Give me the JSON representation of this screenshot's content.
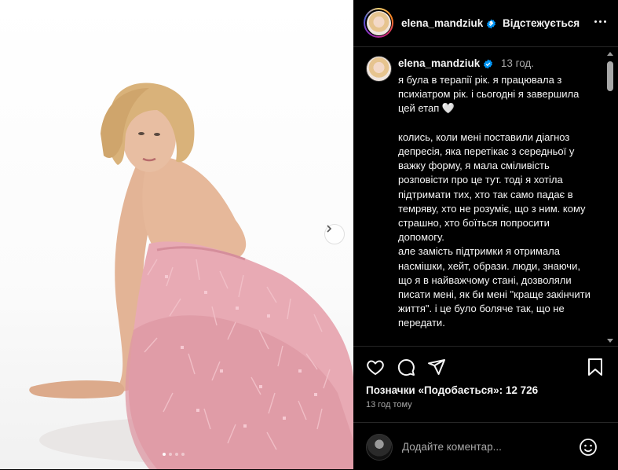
{
  "post": {
    "username": "elena_mandziuk",
    "follow_status": "Відстежується",
    "separator": "•",
    "time_ago": "13 год.",
    "caption": "я була в терапії рік. я працювала з психіатром рік. і сьогодні я завершила цей етап 🤍\n\nколись, коли мені поставили діагноз депресія, яка перетікає з середньої у важку форму, я мала сміливість розповісти про це тут. тоді я хотіла підтримати тих, хто так само падає в темряву, хто не розуміє, що з ним. кому страшно, хто боїться попросити допомогу.\nале замість підтримки я отримала насмішки, хейт, образи. люди, знаючи, що я в найважчому стані, дозволяли писати мені, як би мені \"краще закінчити життя\". і це було боляче так, що не передати.\n\nдепресія - це не поганий настрій. це",
    "likes": "Позначки «Подобається»: 12 726",
    "timestamp": "13 год тому"
  },
  "comment": {
    "placeholder": "Додайте коментар..."
  },
  "icons": {
    "verified": "verified-badge-icon",
    "more": "more-options-icon",
    "like": "heart-icon",
    "comment": "comment-bubble-icon",
    "share": "paper-plane-icon",
    "save": "bookmark-icon",
    "emoji": "emoji-smile-icon",
    "next": "chevron-right-icon"
  },
  "colors": {
    "accent": "#0095f6",
    "background": "#000000",
    "text": "#f5f5f5",
    "muted": "#a8a8a8",
    "dress": "#e8aab4"
  }
}
